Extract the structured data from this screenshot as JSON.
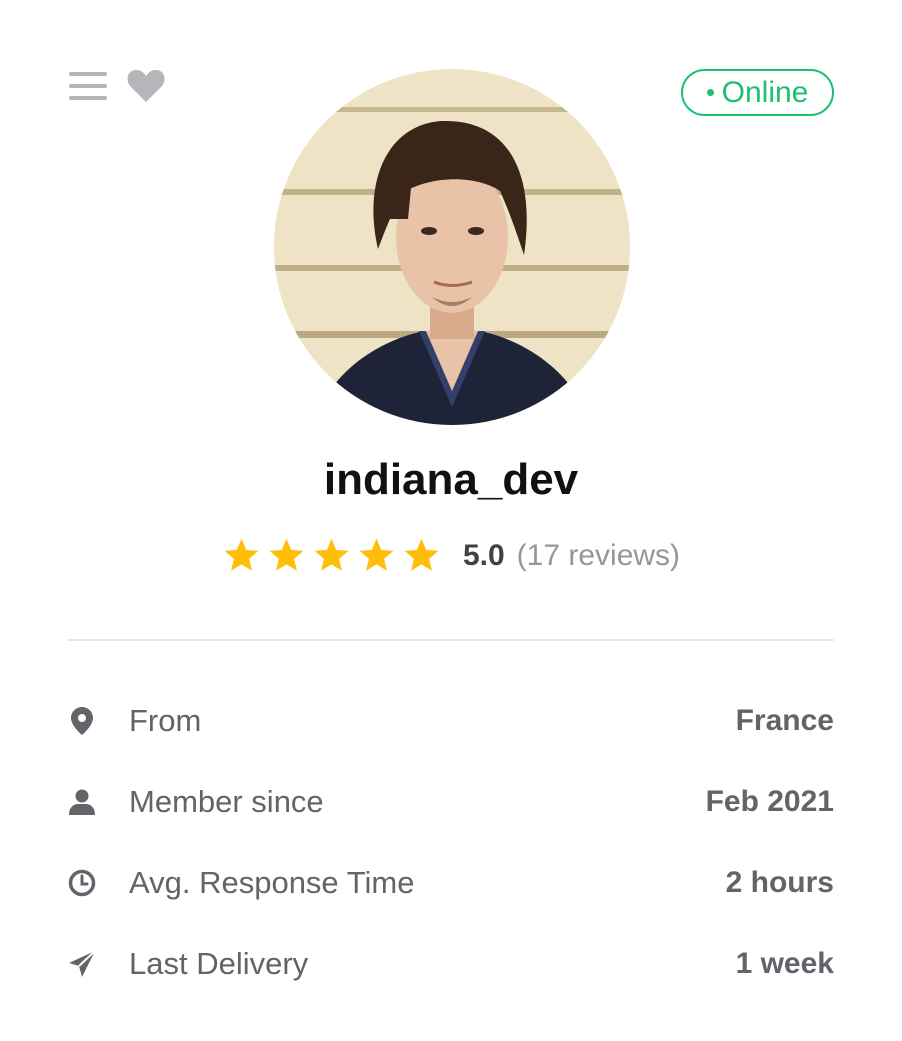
{
  "profile": {
    "status": "Online",
    "username": "indiana_dev",
    "rating": {
      "stars": 5,
      "score": "5.0",
      "reviews": "(17 reviews)"
    }
  },
  "stats": [
    {
      "icon": "location-pin-icon",
      "label": "From",
      "value": "France"
    },
    {
      "icon": "user-icon",
      "label": "Member since",
      "value": "Feb 2021"
    },
    {
      "icon": "clock-icon",
      "label": "Avg. Response Time",
      "value": "2 hours"
    },
    {
      "icon": "paper-plane-icon",
      "label": "Last Delivery",
      "value": "1 week"
    }
  ],
  "colors": {
    "online": "#1dbf73",
    "star": "#ffbe0b",
    "icon": "#b5b6ba",
    "text_muted": "#62646a"
  }
}
